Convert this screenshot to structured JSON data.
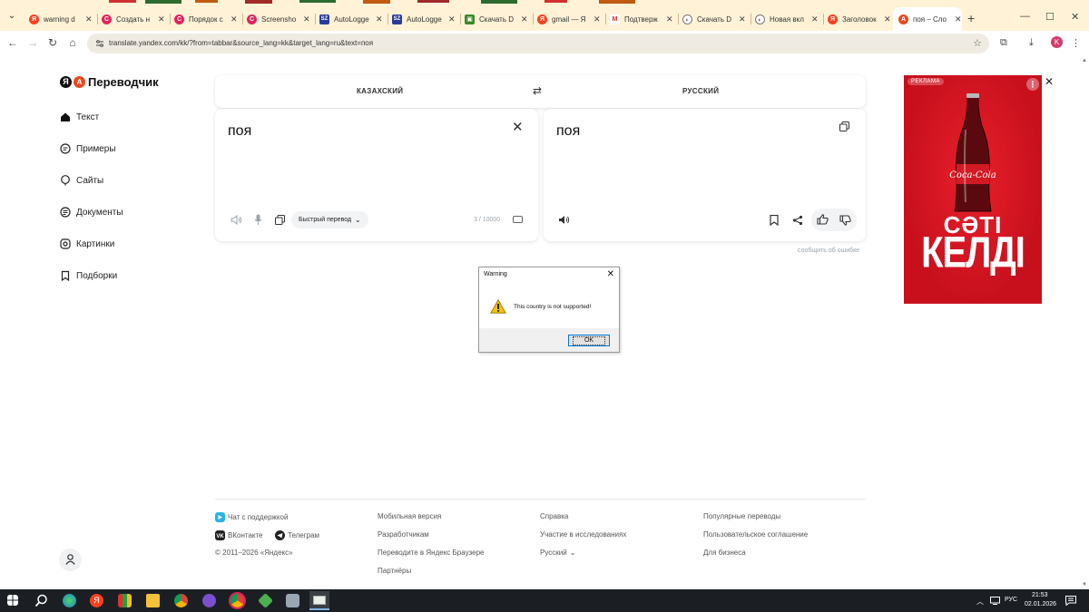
{
  "browser": {
    "tabs": [
      {
        "title": "warning d",
        "fav": "Я",
        "fav_color": "#fc3f1d"
      },
      {
        "title": "Создать н",
        "fav": "C",
        "fav_color": "#e0245e"
      },
      {
        "title": "Порядок с",
        "fav": "C",
        "fav_color": "#e0245e"
      },
      {
        "title": "Screensho",
        "fav": "C",
        "fav_color": "#e0245e"
      },
      {
        "title": "AutoLogge",
        "fav": "SZ",
        "fav_color": "#2b3b9a"
      },
      {
        "title": "AutoLogge",
        "fav": "SZ",
        "fav_color": "#2b3b9a"
      },
      {
        "title": "Скачать D",
        "fav": "▣",
        "fav_color": "#3a8a2a"
      },
      {
        "title": "gmail — Я",
        "fav": "Я",
        "fav_color": "#fc3f1d"
      },
      {
        "title": "Подтверж",
        "fav": "M",
        "fav_color": "#d93025"
      },
      {
        "title": "Скачать D",
        "fav": "◐",
        "fav_color": "#777777"
      },
      {
        "title": "Новая вкл",
        "fav": "◐",
        "fav_color": "#777777"
      },
      {
        "title": "Заголовок",
        "fav": "Я",
        "fav_color": "#fc3f1d"
      },
      {
        "title": "поя – Сло",
        "fav": "A",
        "fav_color": "#e8491d",
        "active": true
      }
    ],
    "new_tab": "+",
    "url": "translate.yandex.com/kk/?from=tabbar&source_lang=kk&target_lang=ru&text=поя",
    "profile_letter": "K"
  },
  "app": {
    "logo_text": "Переводчик",
    "sidebar": [
      {
        "label": "Текст",
        "icon": "home-icon"
      },
      {
        "label": "Примеры",
        "icon": "examples-icon"
      },
      {
        "label": "Сайты",
        "icon": "sites-icon"
      },
      {
        "label": "Документы",
        "icon": "documents-icon"
      },
      {
        "label": "Картинки",
        "icon": "images-icon"
      },
      {
        "label": "Подборки",
        "icon": "collections-icon"
      }
    ],
    "source_lang": "КАЗАХСКИЙ",
    "target_lang": "РУССКИЙ",
    "source_text": "поя",
    "target_text": "поя",
    "fast_translate": "Быстрый перевод",
    "counter": "3 / 10000",
    "report_error": "сообщить об ошибке"
  },
  "ad": {
    "tag": "РЕКЛАМА",
    "brand": "Coca-Cola",
    "line1": "СƏТІ",
    "line2": "КЕЛДІ"
  },
  "dialog": {
    "title": "Warning",
    "message": "This country is not supported!",
    "ok": "OK"
  },
  "footer": {
    "col1": [
      "Чат с поддержкой",
      "ВКонтакте",
      "Телеграм",
      "© 2011–2026 «Яндекс»"
    ],
    "col2": [
      "Мобильная версия",
      "Разработчикам",
      "Переводите в Яндекс Браузере",
      "Партнёры"
    ],
    "col3": [
      "Справка",
      "Участие в исследованиях",
      "Русский"
    ],
    "col4": [
      "Популярные переводы",
      "Пользовательское соглашение",
      "Для бизнеса"
    ]
  },
  "taskbar": {
    "lang": "РУС",
    "time": "21:53",
    "date": "02.01.2026"
  }
}
